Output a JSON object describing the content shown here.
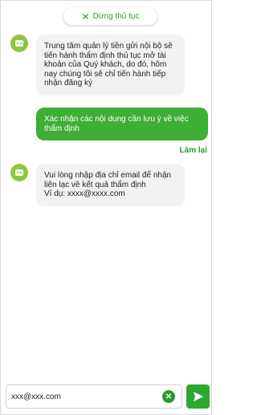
{
  "header": {
    "stop_label": "Dừng thủ tục",
    "stop_icon": "close-icon"
  },
  "messages": [
    {
      "sender": "bot",
      "avatar_icon": "bot-icon",
      "text": "Trung tâm quản lý tiền gửi nội bộ sẽ tiến hành thẩm định thủ tục mở tài khoản của Quý khách, do đó, hôm nay chúng tôi sẽ chỉ tiến hành tiếp nhận đăng ký"
    },
    {
      "sender": "user",
      "text": "Xác nhận các nội dung cần lưu ý về việc thẩm định",
      "action_label": "Làm lại"
    },
    {
      "sender": "bot",
      "avatar_icon": "bot-icon",
      "text_line1": "Vui lòng nhập địa chỉ email để nhận liên lạc về kết quả thẩm định",
      "text_line2": "Ví dụ: xxxx@xxxx.com"
    }
  ],
  "input": {
    "value": "xxx@xxx.com",
    "clear_icon": "clear-icon",
    "send_icon": "send-icon"
  },
  "colors": {
    "accent": "#2b9a2f",
    "user_bubble": "#3eae35",
    "bot_bubble": "#f2f2f2",
    "avatar": "#8cc63f"
  }
}
